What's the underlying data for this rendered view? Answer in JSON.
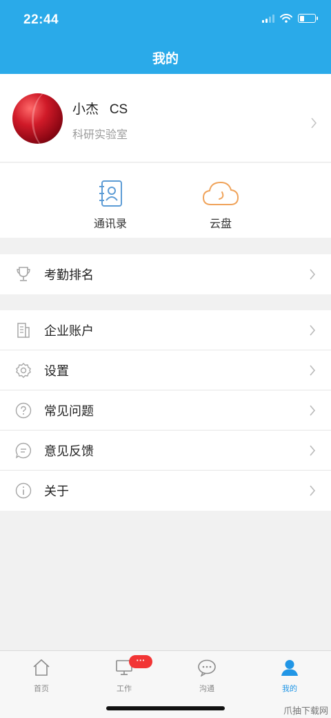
{
  "status_bar": {
    "time": "22:44"
  },
  "nav": {
    "title": "我的"
  },
  "profile": {
    "name": "小杰   CS",
    "department": "科研实验室"
  },
  "quick_actions": [
    {
      "label": "通讯录",
      "icon": "contacts-book-icon"
    },
    {
      "label": "云盘",
      "icon": "cloud-icon"
    }
  ],
  "menu_group_1": [
    {
      "label": "考勤排名",
      "icon": "trophy-icon"
    }
  ],
  "menu_group_2": [
    {
      "label": "企业账户",
      "icon": "building-icon"
    },
    {
      "label": "设置",
      "icon": "gear-icon"
    },
    {
      "label": "常见问题",
      "icon": "question-icon"
    },
    {
      "label": "意见反馈",
      "icon": "feedback-icon"
    },
    {
      "label": "关于",
      "icon": "info-icon"
    }
  ],
  "tab_bar": {
    "tabs": [
      {
        "label": "首页",
        "icon": "home-icon",
        "active": false
      },
      {
        "label": "工作",
        "icon": "monitor-icon",
        "active": false,
        "badge": "···"
      },
      {
        "label": "沟通",
        "icon": "chat-icon",
        "active": false
      },
      {
        "label": "我的",
        "icon": "person-icon",
        "active": true
      }
    ]
  },
  "colors": {
    "primary": "#2aaae9",
    "active_tab": "#2196e6",
    "badge": "#f23535",
    "contacts_icon": "#5b9bd5",
    "cloud_icon": "#f0a35a"
  },
  "watermark": "爪抽下载网"
}
